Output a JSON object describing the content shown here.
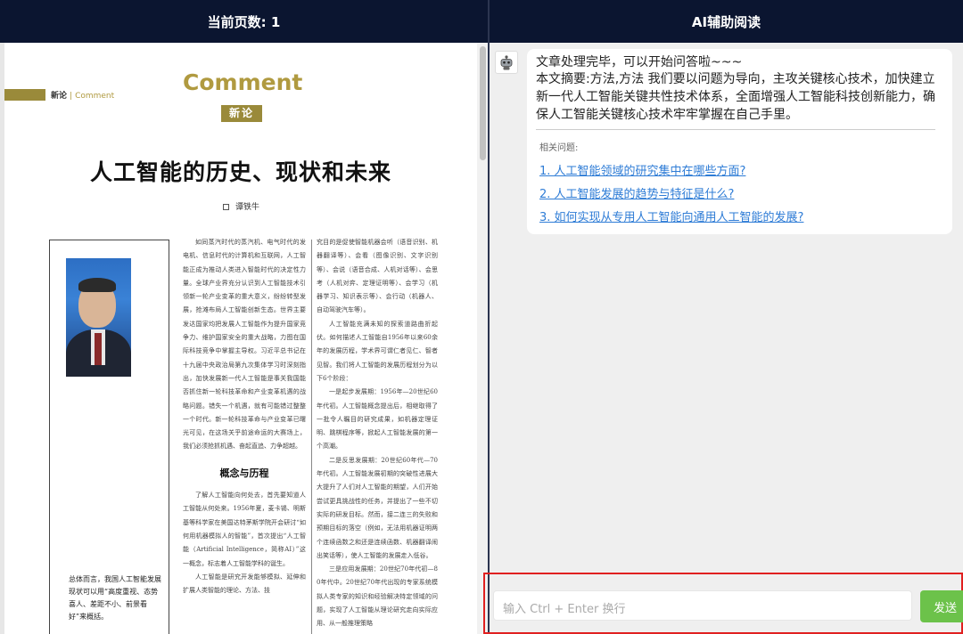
{
  "header": {
    "page_count_label": "当前页数: 1",
    "ai_title": "AI辅助阅读"
  },
  "pdf": {
    "section_cn": "新论",
    "section_sep": "|",
    "section_en": "Comment",
    "comment_title": "Comment",
    "badge": "新论",
    "article_title": "人工智能的历史、现状和未来",
    "author": "谭铁牛",
    "sidebar_text": "总体而言，我国人工智能发展现状可以用“高度重视、态势喜人、差距不小、前景看好”来概括。",
    "col1_paragraphs": [
      "如同蒸汽时代的蒸汽机、电气时代的发电机、信息时代的计算机和互联网，人工智能正成为推动人类进入智能时代的决定性力量。全球产业界充分认识到人工智能技术引领新一轮产业变革的重大意义，纷纷转型发展，抢滩布局人工智能创新生态。世界主要发达国家均把发展人工智能作为提升国家竞争力、维护国家安全的重大战略，力图在国际科技竞争中掌握主导权。习近平总书记在十九届中央政治局第九次集体学习时深刻指出，加快发展新一代人工智能是事关我国能否抓住新一轮科技革命和产业变革机遇的战略问题。错失一个机遇，就有可能错过整整一个时代。新一轮科技革命与产业变革已曙光可见，在这场关乎前途命运的大赛场上，我们必须抢抓机遇、奋起直追、力争超越。"
    ],
    "col1_subhead": "概念与历程",
    "col1_paragraphs_2": [
      "了解人工智能向何处去，首先要知道人工智能从何处来。1956年夏，麦卡锡、明斯基等科学家在美国达特茅斯学院开会研讨“如何用机器模拟人的智能”，首次提出“人工智能（Artificial Intelligence，简称AI）”这一概念，标志着人工智能学科的诞生。",
      "人工智能是研究开发能够模拟、延伸和扩展人类智能的理论、方法、技"
    ],
    "col2_paragraphs": [
      "究目的是促使智能机器会听（语音识别、机器翻译等）、会看（图像识别、文字识别等）、会说（语音合成、人机对话等）、会思考（人机对弈、定理证明等）、会学习（机器学习、知识表示等）、会行动（机器人、自动驾驶汽车等）。",
      "人工智能充满未知的探索道路曲折起伏。如何描述人工智能自1956年以来60余年的发展历程，学术界可谓仁者见仁、智者见智。我们将人工智能的发展历程划分为以下6个阶段：",
      "一是起步发展期：1956年—20世纪60年代初。人工智能概念提出后，相继取得了一批令人瞩目的研究成果，如机器定理证明、跳棋程序等，掀起人工智能发展的第一个高潮。",
      "二是反思发展期：20世纪60年代—70年代初。人工智能发展初期的突破性进展大大提升了人们对人工智能的期望，人们开始尝试更具挑战性的任务，并提出了一些不切实际的研发目标。然而，接二连三的失败和预期目标的落空（例如，无法用机器证明两个连续函数之和还是连续函数、机器翻译闹出笑话等），使人工智能的发展走入低谷。",
      "三是应用发展期：20世纪70年代初—80年代中。20世纪70年代出现的专家系统模拟人类专家的知识和经验解决特定领域的问题，实现了人工智能从理论研究走向实际应用、从一般推理策略"
    ]
  },
  "ai": {
    "greeting": "文章处理完毕，可以开始问答啦~~~",
    "summary": "本文摘要:方法,方法 我们要以问题为导向，主攻关键核心技术，加快建立新一代人工智能关键共性技术体系，全面增强人工智能科技创新能力，确保人工智能关键核心技术牢牢掌握在自己手里。",
    "related_label": "相关问题:",
    "questions": [
      "1. 人工智能领域的研究集中在哪些方面?",
      "2. 人工智能发展的趋势与特征是什么?",
      "3. 如何实现从专用人工智能向通用人工智能的发展?"
    ],
    "input_placeholder": "输入 Ctrl + Enter 换行",
    "send_label": "发送"
  },
  "colors": {
    "header_bg": "#0b1530",
    "gold": "#b09a40",
    "link": "#2e7cd6",
    "send_green": "#6cc24a",
    "highlight_red": "#e02020"
  }
}
